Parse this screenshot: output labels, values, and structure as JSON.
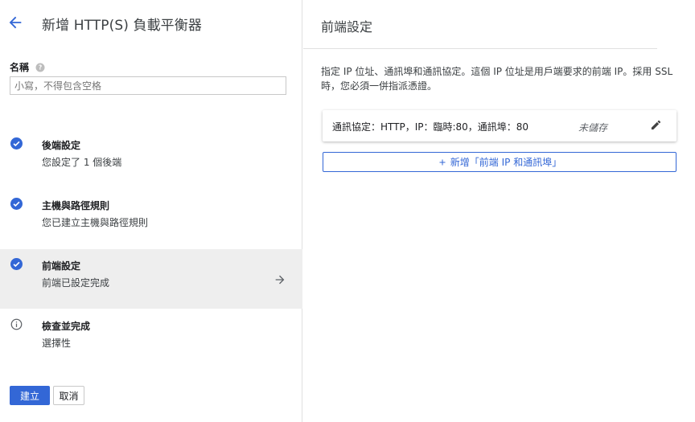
{
  "header": {
    "title": "新增 HTTP(S) 負載平衡器",
    "back_icon": "arrow-back-icon"
  },
  "name_field": {
    "label": "名稱",
    "placeholder": "小寫，不得包含空格",
    "value": ""
  },
  "steps": [
    {
      "title": "後端設定",
      "subtitle": "您設定了 1 個後端",
      "icon": "check-circle-icon",
      "active": false
    },
    {
      "title": "主機與路徑規則",
      "subtitle": "您已建立主機與路徑規則",
      "icon": "check-circle-icon",
      "active": false
    },
    {
      "title": "前端設定",
      "subtitle": "前端已設定完成",
      "icon": "check-circle-icon",
      "active": true
    },
    {
      "title": "檢查並完成",
      "subtitle": "選擇性",
      "icon": "info-icon",
      "active": false
    }
  ],
  "actions": {
    "create_label": "建立",
    "cancel_label": "取消"
  },
  "frontend": {
    "title": "前端設定",
    "description": "指定 IP 位址、通訊埠和通訊協定。這個 IP 位址是用戶端要求的前端 IP。採用 SSL 時，您必須一併指派憑證。",
    "entry": {
      "text": "通訊協定：HTTP，IP：臨時:80，通訊埠：80",
      "status": "未儲存"
    },
    "add_label": "新增「前端 IP 和通訊埠」"
  },
  "colors": {
    "accent": "#3367d6",
    "check": "#3367d6",
    "active_bg": "#eeeeee"
  }
}
